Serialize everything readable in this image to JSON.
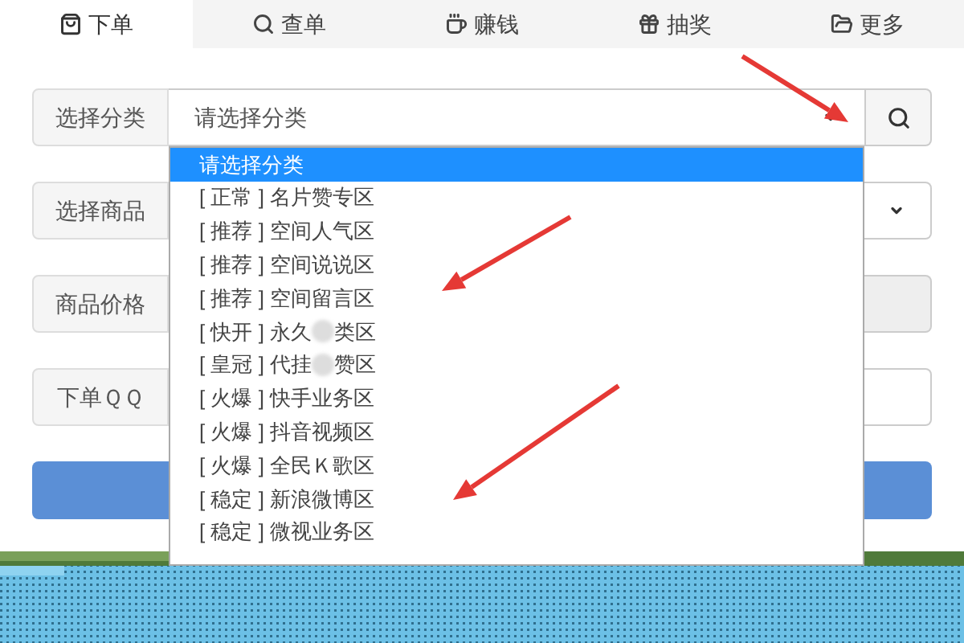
{
  "tabs": [
    {
      "label": "下单",
      "selected": true
    },
    {
      "label": "查单",
      "selected": false
    },
    {
      "label": "赚钱",
      "selected": false
    },
    {
      "label": "抽奖",
      "selected": false
    },
    {
      "label": "更多",
      "selected": false
    }
  ],
  "form": [
    {
      "label": "选择分类",
      "kind": "select",
      "value": "请选择分类",
      "search": true
    },
    {
      "label": "选择商品",
      "kind": "select"
    },
    {
      "label": "商品价格",
      "kind": "readonly"
    },
    {
      "label": "下单ＱＱ",
      "kind": "input"
    }
  ],
  "dropdown": {
    "options": [
      {
        "text": "请选择分类",
        "selected": true
      },
      {
        "text": "[ 正常 ] 名片赞专区",
        "selected": false
      },
      {
        "text": "[ 推荐 ] 空间人气区",
        "selected": false
      },
      {
        "text": "[ 推荐 ] 空间说说区",
        "selected": false
      },
      {
        "text": "[ 推荐 ] 空间留言区",
        "selected": false
      },
      {
        "text": "[ 快开 ] 永久",
        "redacted": true,
        "text_end": "类区",
        "selected": false
      },
      {
        "text": "[ 皇冠 ] 代挂",
        "redacted": true,
        "text_end": "赞区",
        "selected": false
      },
      {
        "text": "[ 火爆 ] 快手业务区",
        "selected": false
      },
      {
        "text": "[ 火爆 ] 抖音视频区",
        "selected": false
      },
      {
        "text": "[ 火爆 ] 全民Ｋ歌区",
        "selected": false
      },
      {
        "text": "[ 稳定 ] 新浪微博区",
        "selected": false
      },
      {
        "text": "[ 稳定 ] 微视业务区",
        "selected": false
      }
    ]
  }
}
